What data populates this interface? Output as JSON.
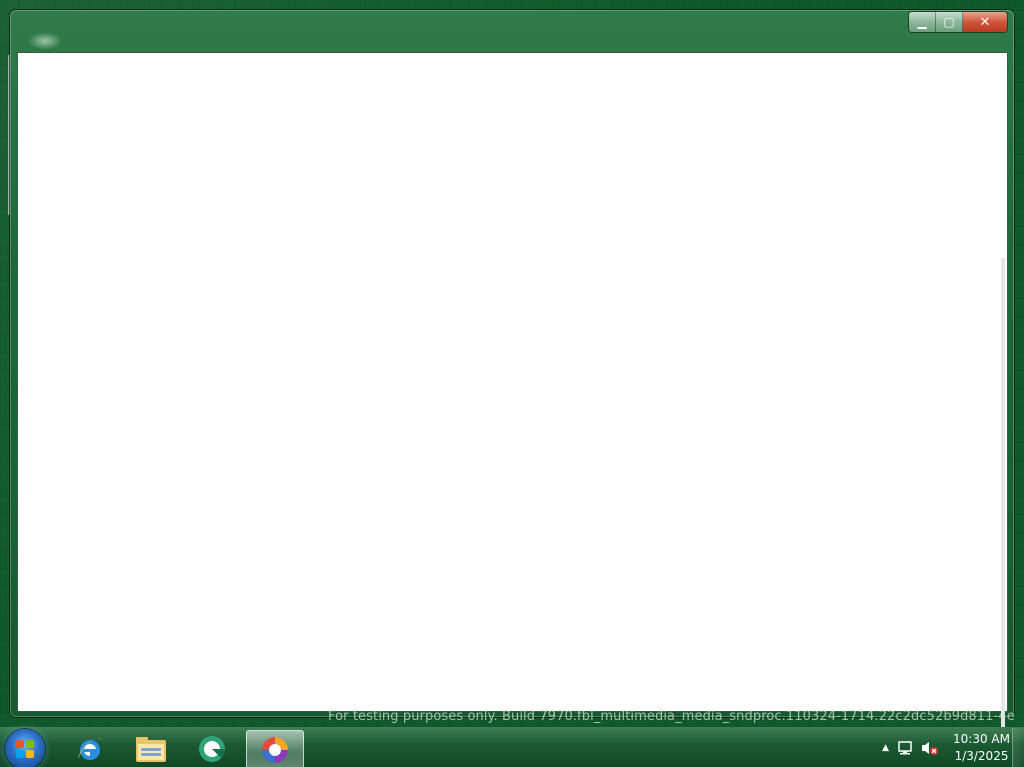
{
  "desktop": {
    "background_color": "#0f5a2a"
  },
  "window": {
    "buttons": {
      "minimize_glyph": "▁",
      "maximize_glyph": "▢",
      "close_glyph": "✕"
    },
    "client_background": "#ffffff"
  },
  "watermark": {
    "text": "For testing purposes only. Build 7970.fbl_multimedia_media_sndproc.110324-1714.22c2dc52b9d811-4e"
  },
  "taskbar": {
    "pinned": [
      {
        "name": "start-orb-icon"
      },
      {
        "name": "internet-explorer-icon"
      },
      {
        "name": "windows-explorer-icon"
      },
      {
        "name": "app-green-circle-icon"
      },
      {
        "name": "paint-app-icon",
        "active": true
      }
    ],
    "tray": {
      "show_hidden_glyph": "▲",
      "icons": [
        "network-icon",
        "volume-muted-icon"
      ],
      "time": "10:30 AM",
      "date": "1/3/2025"
    }
  }
}
